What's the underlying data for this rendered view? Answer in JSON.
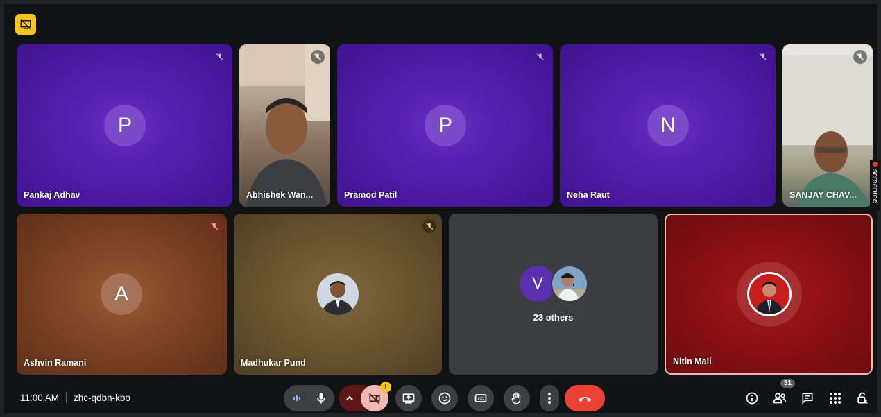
{
  "participants_top": [
    {
      "name": "Pankaj Adhav",
      "initial": "P"
    },
    {
      "name": "Abhishek Wan..."
    },
    {
      "name": "Pramod Patil",
      "initial": "P"
    },
    {
      "name": "Neha Raut",
      "initial": "N"
    },
    {
      "name": "SANJAY CHAV..."
    }
  ],
  "participants_bottom": [
    {
      "name": "Ashvin Ramani",
      "initial": "A"
    },
    {
      "name": "Madhukar Pund"
    },
    {
      "others_initial": "V",
      "others_label": "23 others"
    },
    {
      "name": "Nitin Mali"
    }
  ],
  "meeting": {
    "time": "11:00 AM",
    "code": "zhc-qdbn-kbo",
    "people_count": "31",
    "warning": "!"
  },
  "screenrec": "screenrec",
  "colors": {
    "accent_yellow": "#f9c51a",
    "end_call_red": "#ea4335",
    "tile_purple": "#4a189e",
    "tile_active_border": "#f0b7b0"
  }
}
